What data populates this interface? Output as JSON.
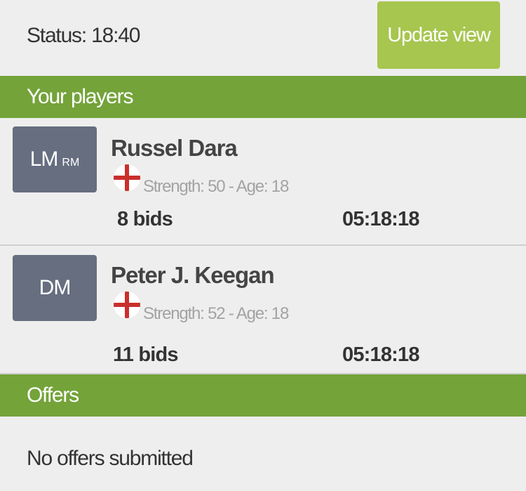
{
  "status": {
    "label": "Status: 18:40"
  },
  "toolbar": {
    "update_label": "Update view"
  },
  "players_section": {
    "title": "Your players"
  },
  "players": [
    {
      "position": "LM",
      "secondary_position": "RM",
      "name": "Russel Dara",
      "flag": "england-flag",
      "info": "Strength: 50 - Age: 18",
      "bids": "8 bids",
      "time_left": "05:18:18"
    },
    {
      "position": "DM",
      "secondary_position": "",
      "name": "Peter J. Keegan",
      "flag": "england-flag",
      "info": "Strength: 52 - Age: 18",
      "bids": "11 bids",
      "time_left": "05:18:18"
    }
  ],
  "offers_section": {
    "title": "Offers",
    "empty_text": "No offers submitted"
  },
  "colors": {
    "background": "#eeeeee",
    "section_green": "#74a33a",
    "button_green": "#a6c64f",
    "position_box": "#666e7f",
    "flag_cross": "#c9302c"
  }
}
